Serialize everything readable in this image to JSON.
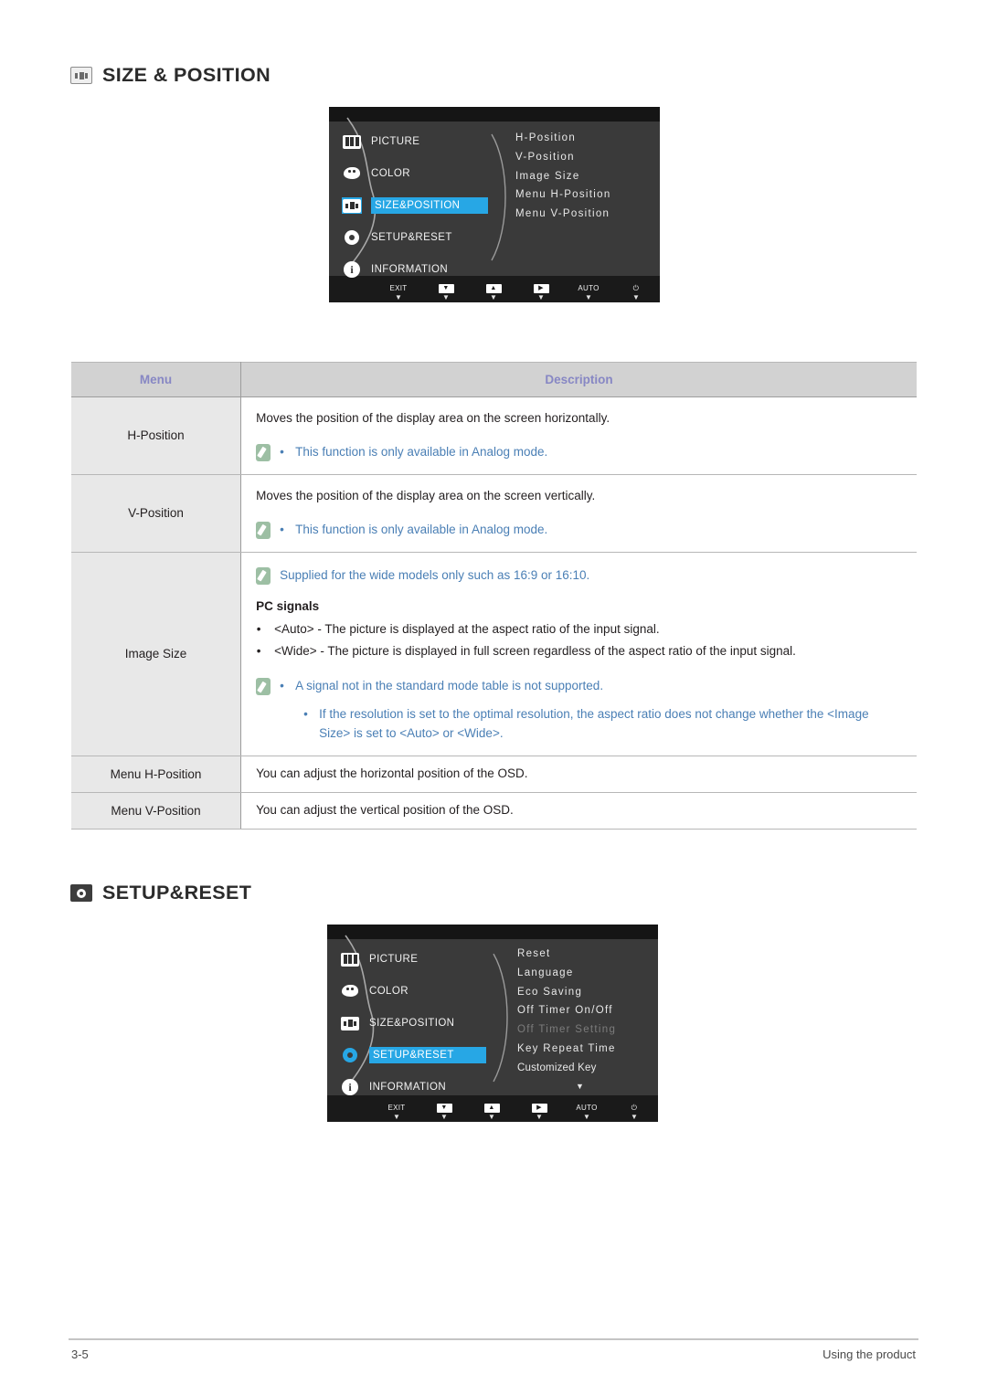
{
  "sections": [
    {
      "id": "size-position",
      "heading": "SIZE & POSITION",
      "icon": "size-position-icon"
    },
    {
      "id": "setup-reset",
      "heading": "SETUP&RESET",
      "icon": "setup-reset-icon"
    }
  ],
  "osd_size_position": {
    "menu_items": [
      {
        "label": "PICTURE",
        "icon": "picture-icon",
        "selected": false
      },
      {
        "label": "COLOR",
        "icon": "color-icon",
        "selected": false
      },
      {
        "label": "SIZE&POSITION",
        "icon": "size-position-icon",
        "selected": true
      },
      {
        "label": "SETUP&RESET",
        "icon": "gear-icon",
        "selected": false
      },
      {
        "label": "INFORMATION",
        "icon": "information-icon",
        "selected": false
      }
    ],
    "sub_items": [
      {
        "label": "H-Position",
        "dim": false
      },
      {
        "label": "V-Position",
        "dim": false
      },
      {
        "label": "Image Size",
        "dim": false
      },
      {
        "label": "Menu H-Position",
        "dim": false
      },
      {
        "label": "Menu V-Position",
        "dim": false
      }
    ],
    "more_arrow": "",
    "keys": [
      {
        "cap": "EXIT",
        "type": "text",
        "tick": "▼"
      },
      {
        "cap": "▼",
        "type": "box",
        "tick": "▼"
      },
      {
        "cap": "▲",
        "type": "box",
        "tick": "▼"
      },
      {
        "cap": "▶",
        "type": "box",
        "tick": "▼"
      },
      {
        "cap": "AUTO",
        "type": "text",
        "tick": "▼"
      },
      {
        "cap": "⏻",
        "type": "text",
        "tick": "▼"
      }
    ],
    "highlight_color": "#27a7e5"
  },
  "osd_setup_reset": {
    "menu_items": [
      {
        "label": "PICTURE",
        "icon": "picture-icon",
        "selected": false
      },
      {
        "label": "COLOR",
        "icon": "color-icon",
        "selected": false
      },
      {
        "label": "SIZE&POSITION",
        "icon": "size-position-icon",
        "selected": false
      },
      {
        "label": "SETUP&RESET",
        "icon": "gear-icon",
        "selected": true
      },
      {
        "label": "INFORMATION",
        "icon": "information-icon",
        "selected": false
      }
    ],
    "sub_items": [
      {
        "label": "Reset",
        "dim": false
      },
      {
        "label": "Language",
        "dim": false
      },
      {
        "label": "Eco Saving",
        "dim": false
      },
      {
        "label": "Off Timer On/Off",
        "dim": false
      },
      {
        "label": "Off Timer Setting",
        "dim": true
      },
      {
        "label": "Key Repeat Time",
        "dim": false
      },
      {
        "label": "Customized Key",
        "dim": false
      }
    ],
    "more_arrow": "▼",
    "keys": [
      {
        "cap": "EXIT",
        "type": "text",
        "tick": "▼"
      },
      {
        "cap": "▼",
        "type": "box",
        "tick": "▼"
      },
      {
        "cap": "▲",
        "type": "box",
        "tick": "▼"
      },
      {
        "cap": "▶",
        "type": "box",
        "tick": "▼"
      },
      {
        "cap": "AUTO",
        "type": "text",
        "tick": "▼"
      },
      {
        "cap": "⏻",
        "type": "text",
        "tick": "▼"
      }
    ],
    "highlight_color": "#27a7e5"
  },
  "table": {
    "headers": {
      "menu": "Menu",
      "description": "Description"
    },
    "rows": {
      "h_position": {
        "menu": "H-Position",
        "line1": "Moves the position of the display area on the screen horizontally.",
        "note": "This function is only available in Analog mode."
      },
      "v_position": {
        "menu": "V-Position",
        "line1": "Moves the position of the display area on the screen vertically.",
        "note": "This function is only available in Analog mode."
      },
      "image_size": {
        "menu": "Image Size",
        "note_top": "Supplied for the wide models only such as 16:9 or 16:10.",
        "subhead": "PC signals",
        "bullets": [
          "<Auto> - The picture is displayed at the aspect ratio of the input signal.",
          "<Wide> - The picture is displayed in full screen regardless of the aspect ratio of the input signal."
        ],
        "note1": "A signal not in the standard mode table is not supported.",
        "note2": "If the resolution is set to the optimal resolution, the aspect ratio does not change whether the <Image Size> is set to <Auto> or <Wide>."
      },
      "menu_h_position": {
        "menu": "Menu H-Position",
        "line1": "You can adjust the horizontal position of the OSD."
      },
      "menu_v_position": {
        "menu": "Menu V-Position",
        "line1": "You can adjust the vertical position of the OSD."
      }
    },
    "bullet_glyph": "•"
  },
  "footer": {
    "page_number": "3-5",
    "chapter": "Using the product"
  },
  "colors": {
    "header_text": "#8787c4",
    "note_text": "#4a7fb5",
    "note_icon_bg": "#9dbfa4",
    "osd_highlight": "#27a7e5"
  }
}
